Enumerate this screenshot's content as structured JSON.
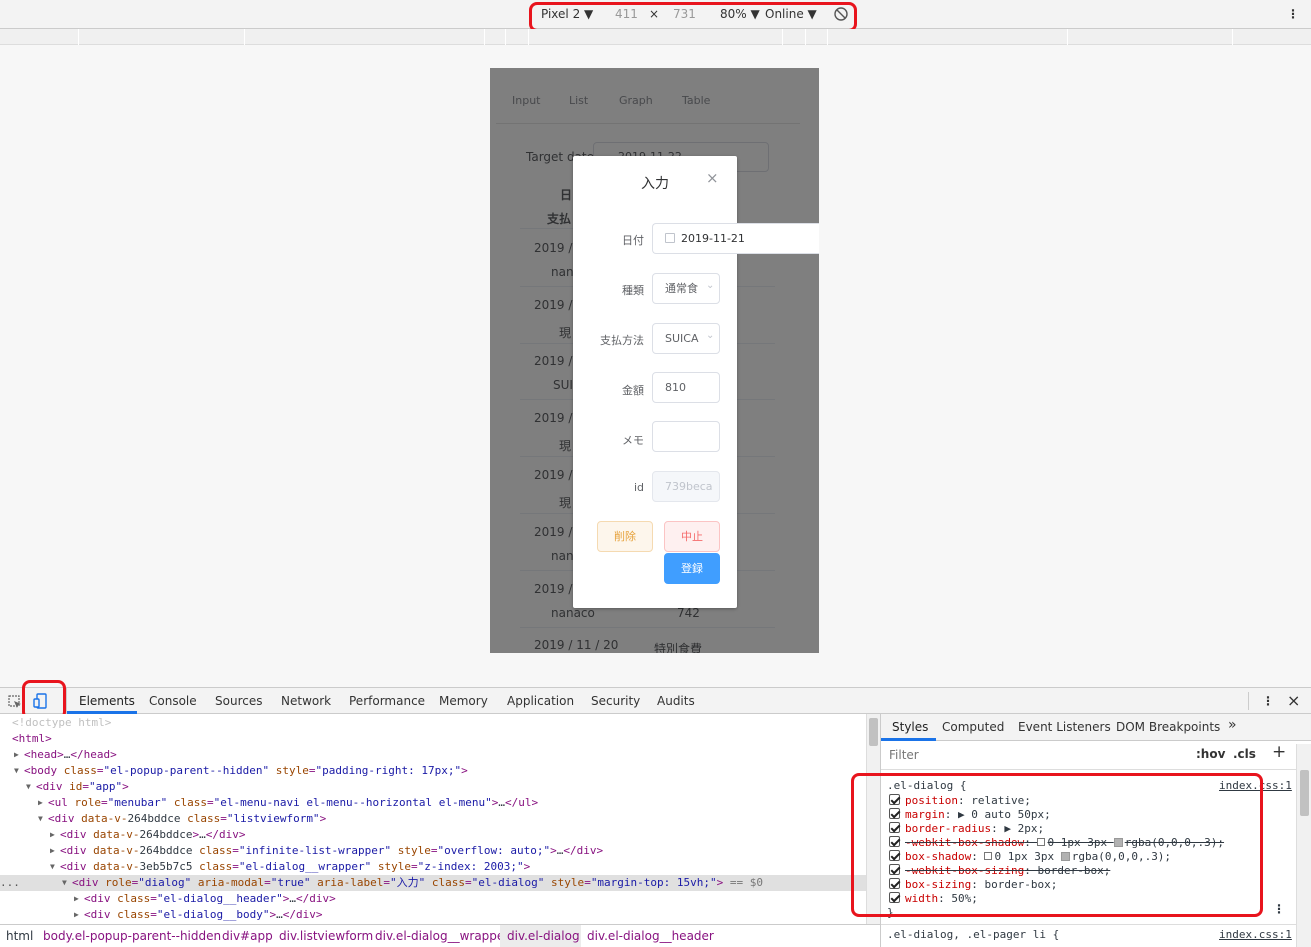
{
  "device_toolbar": {
    "device": "Pixel 2",
    "width": "411",
    "times": "×",
    "height": "731",
    "zoom": "80%",
    "network": "Online",
    "caret": "▼",
    "more": "⋮"
  },
  "app": {
    "nav": [
      "Input",
      "List",
      "Graph",
      "Table"
    ],
    "target_date_label": "Target date",
    "target_date_value": "2019-11-22",
    "col1": "日",
    "col2": "支払",
    "rows": [
      {
        "date": "2019 /",
        "method": "nan"
      },
      {
        "date": "2019 /",
        "method": "現"
      },
      {
        "date": "2019 /",
        "method": "SUI"
      },
      {
        "date": "2019 /",
        "method": "現"
      },
      {
        "date": "2019 /",
        "method": "現"
      },
      {
        "date": "2019 /",
        "method": "nan"
      },
      {
        "date": "2019 /",
        "method": "nanaco",
        "amount": "742"
      },
      {
        "date": "2019 / 11 / 20",
        "method": "特別食費"
      }
    ]
  },
  "dialog": {
    "title": "入力",
    "close": "×",
    "date_label": "日付",
    "date_value": "2019-11-21",
    "type_label": "種類",
    "type_value": "通常食",
    "payment_label": "支払方法",
    "payment_value": "SUICA",
    "amount_label": "金額",
    "amount_value": "810",
    "memo_label": "メモ",
    "memo_value": "",
    "id_label": "id",
    "id_value": "739beca",
    "delete_label": "削除",
    "cancel_label": "中止",
    "register_label": "登録"
  },
  "devtools": {
    "tabs": [
      "Elements",
      "Console",
      "Sources",
      "Network",
      "Performance",
      "Memory",
      "Application",
      "Security",
      "Audits"
    ],
    "elements": [
      {
        "indent": 0,
        "arrow": "",
        "html": "<!doctype html>",
        "kind": "doctype"
      },
      {
        "indent": 0,
        "arrow": "",
        "html": "<html>",
        "kind": "tag"
      },
      {
        "indent": 1,
        "arrow": "▶",
        "html": "<head>…</head>",
        "kind": "tag"
      },
      {
        "indent": 1,
        "arrow": "▼",
        "html": "<body class=\"el-popup-parent--hidden\" style=\"padding-right: 17px;\">",
        "kind": "tag"
      },
      {
        "indent": 2,
        "arrow": "▼",
        "html": "<div id=\"app\">",
        "kind": "tag"
      },
      {
        "indent": 3,
        "arrow": "▶",
        "html": "<ul role=\"menubar\" class=\"el-menu-navi el-menu--horizontal el-menu\">…</ul>",
        "kind": "tag"
      },
      {
        "indent": 3,
        "arrow": "▼",
        "html": "<div data-v-264bddce class=\"listviewform\">",
        "kind": "tag"
      },
      {
        "indent": 4,
        "arrow": "▶",
        "html": "<div data-v-264bddce>…</div>",
        "kind": "tag"
      },
      {
        "indent": 4,
        "arrow": "▶",
        "html": "<div data-v-264bddce class=\"infinite-list-wrapper\" style=\"overflow: auto;\">…</div>",
        "kind": "tag"
      },
      {
        "indent": 4,
        "arrow": "▼",
        "html": "<div data-v-3eb5b7c5 class=\"el-dialog__wrapper\" style=\"z-index: 2003;\">",
        "kind": "tag"
      },
      {
        "indent": 5,
        "arrow": "▼",
        "html": "<div role=\"dialog\" aria-modal=\"true\" aria-label=\"入力\" class=\"el-dialog\" style=\"margin-top: 15vh;\"> == $0",
        "kind": "selected"
      },
      {
        "indent": 6,
        "arrow": "▶",
        "html": "<div class=\"el-dialog__header\">…</div>",
        "kind": "tag"
      },
      {
        "indent": 6,
        "arrow": "▶",
        "html": "<div class=\"el-dialog__body\">…</div>",
        "kind": "tag"
      }
    ],
    "ellipsis": "...",
    "breadcrumbs": [
      "html",
      "body.el-popup-parent--hidden",
      "div#app",
      "div.listviewform",
      "div.el-dialog__wrapper",
      "div.el-dialog",
      "div.el-dialog__header"
    ],
    "styles_tabs": [
      "Styles",
      "Computed",
      "Event Listeners",
      "DOM Breakpoints"
    ],
    "more_tabs": "»",
    "filter_placeholder": "Filter",
    "hov": ":hov",
    "cls": ".cls",
    "plus": "+",
    "rule_selector": ".el-dialog {",
    "rule_source": "index.css:1",
    "rule_close": "}",
    "declarations": [
      {
        "prop": "position",
        "value": "relative;",
        "struck": false
      },
      {
        "prop": "margin",
        "value": "▶ 0 auto 50px;",
        "struck": false
      },
      {
        "prop": "border-radius",
        "value": "▶ 2px;",
        "struck": false
      },
      {
        "prop": "-webkit-box-shadow",
        "value": "0 1px 3px rgba(0,0,0,.3);",
        "struck": true,
        "swatch": true
      },
      {
        "prop": "box-shadow",
        "value": "0 1px 3px rgba(0,0,0,.3);",
        "struck": false,
        "swatch": true
      },
      {
        "prop": "-webkit-box-sizing",
        "value": "border-box;",
        "struck": true
      },
      {
        "prop": "box-sizing",
        "value": "border-box;",
        "struck": false
      },
      {
        "prop": "width",
        "value": "50%;",
        "struck": false
      }
    ],
    "next_rule_selector": ".el-dialog, .el-pager li {",
    "next_rule_source": "index.css:1"
  },
  "colors": {
    "highlight": "#e8141d",
    "primary": "#409eff",
    "danger": "#f56c6c",
    "warning": "#e6a23c"
  }
}
